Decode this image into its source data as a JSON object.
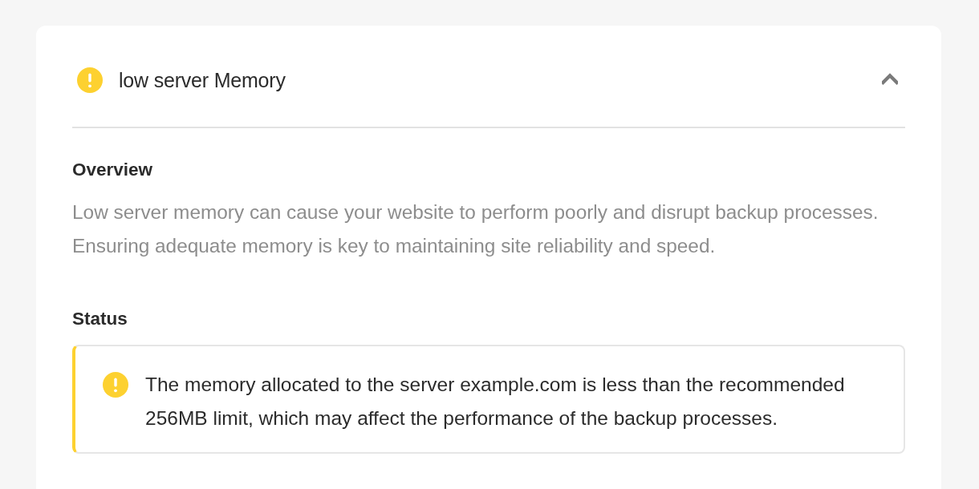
{
  "alert": {
    "kind": "warning",
    "title": "low server Memory",
    "expanded": true
  },
  "sections": [
    {
      "kind": "text",
      "heading": "Overview",
      "body": "Low server memory can cause your website to perform poorly and disrupt backup processes. Ensuring adequate memory is key to maintaining site reliability and speed."
    },
    {
      "kind": "notice",
      "heading": "Status",
      "notice": {
        "kind": "warning",
        "text": "The memory allocated to the server example.com is less than the recommended 256MB limit, which may affect the performance of the backup processes."
      }
    }
  ]
}
